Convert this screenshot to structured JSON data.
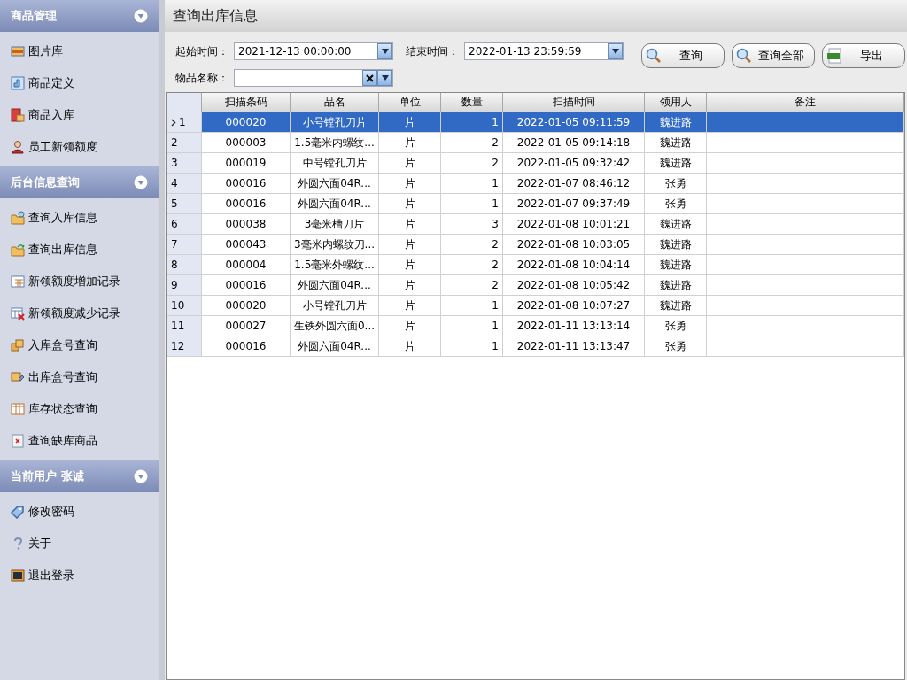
{
  "sidebar": {
    "sections": [
      {
        "title": "商品管理",
        "expanded": true,
        "items": [
          {
            "label": "图片库"
          },
          {
            "label": "商品定义"
          },
          {
            "label": "商品入库"
          },
          {
            "label": "员工新领额度"
          }
        ]
      },
      {
        "title": "后台信息查询",
        "expanded": true,
        "items": [
          {
            "label": "查询入库信息"
          },
          {
            "label": "查询出库信息"
          },
          {
            "label": "新领额度增加记录"
          },
          {
            "label": "新领额度减少记录"
          },
          {
            "label": "入库盒号查询"
          },
          {
            "label": "出库盒号查询"
          },
          {
            "label": "库存状态查询"
          },
          {
            "label": "查询缺库商品"
          }
        ]
      },
      {
        "title": "当前用户 张诚",
        "expanded": true,
        "items": [
          {
            "label": "修改密码"
          },
          {
            "label": "关于"
          },
          {
            "label": "退出登录"
          }
        ]
      }
    ]
  },
  "page_title": "查询出库信息",
  "filters": {
    "start_time": {
      "label": "起始时间：",
      "value": "2021-12-13 00:00:00"
    },
    "end_time": {
      "label": "结束时间：",
      "value": "2022-01-13 23:59:59"
    },
    "item_name": {
      "label": "物品名称："
    }
  },
  "buttons": [
    {
      "label": "查询"
    },
    {
      "label": "查询全部"
    },
    {
      "label": "导出"
    }
  ],
  "table": {
    "columns": [
      "扫描条码",
      "品名",
      "单位",
      "数量",
      "扫描时间",
      "领用人",
      "备注"
    ],
    "rows": [
      {
        "number": "1",
        "selected": true,
        "current": true,
        "cells": [
          "000020",
          "小号镗孔刀片",
          "片",
          "1",
          "2022-01-05 09:11:59",
          "魏进路"
        ]
      },
      {
        "number": "2",
        "selected": false,
        "current": false,
        "cells": [
          "000003",
          "1.5毫米内螺纹...",
          "片",
          "2",
          "2022-01-05 09:14:18",
          "魏进路"
        ]
      },
      {
        "number": "3",
        "selected": false,
        "current": false,
        "cells": [
          "000019",
          "中号镗孔刀片",
          "片",
          "2",
          "2022-01-05 09:32:42",
          "魏进路"
        ]
      },
      {
        "number": "4",
        "selected": false,
        "current": false,
        "cells": [
          "000016",
          "外圆六面04R...",
          "片",
          "1",
          "2022-01-07 08:46:12",
          "张勇"
        ]
      },
      {
        "number": "5",
        "selected": false,
        "current": false,
        "cells": [
          "000016",
          "外圆六面04R...",
          "片",
          "1",
          "2022-01-07 09:37:49",
          "张勇"
        ]
      },
      {
        "number": "6",
        "selected": false,
        "current": false,
        "cells": [
          "000038",
          "3毫米槽刀片",
          "片",
          "3",
          "2022-01-08 10:01:21",
          "魏进路"
        ]
      },
      {
        "number": "7",
        "selected": false,
        "current": false,
        "cells": [
          "000043",
          "3毫米内螺纹刀...",
          "片",
          "2",
          "2022-01-08 10:03:05",
          "魏进路"
        ]
      },
      {
        "number": "8",
        "selected": false,
        "current": false,
        "cells": [
          "000004",
          "1.5毫米外螺纹...",
          "片",
          "2",
          "2022-01-08 10:04:14",
          "魏进路"
        ]
      },
      {
        "number": "9",
        "selected": false,
        "current": false,
        "cells": [
          "000016",
          "外圆六面04R...",
          "片",
          "2",
          "2022-01-08 10:05:42",
          "魏进路"
        ]
      },
      {
        "number": "10",
        "selected": false,
        "current": false,
        "cells": [
          "000020",
          "小号镗孔刀片",
          "片",
          "1",
          "2022-01-08 10:07:27",
          "魏进路"
        ]
      },
      {
        "number": "11",
        "selected": false,
        "current": false,
        "cells": [
          "000027",
          "生铁外圆六面0...",
          "片",
          "1",
          "2022-01-11 13:13:14",
          "张勇"
        ]
      },
      {
        "number": "12",
        "selected": false,
        "current": false,
        "cells": [
          "000016",
          "外圆六面04R...",
          "片",
          "1",
          "2022-01-11 13:13:47",
          "张勇"
        ]
      }
    ]
  }
}
